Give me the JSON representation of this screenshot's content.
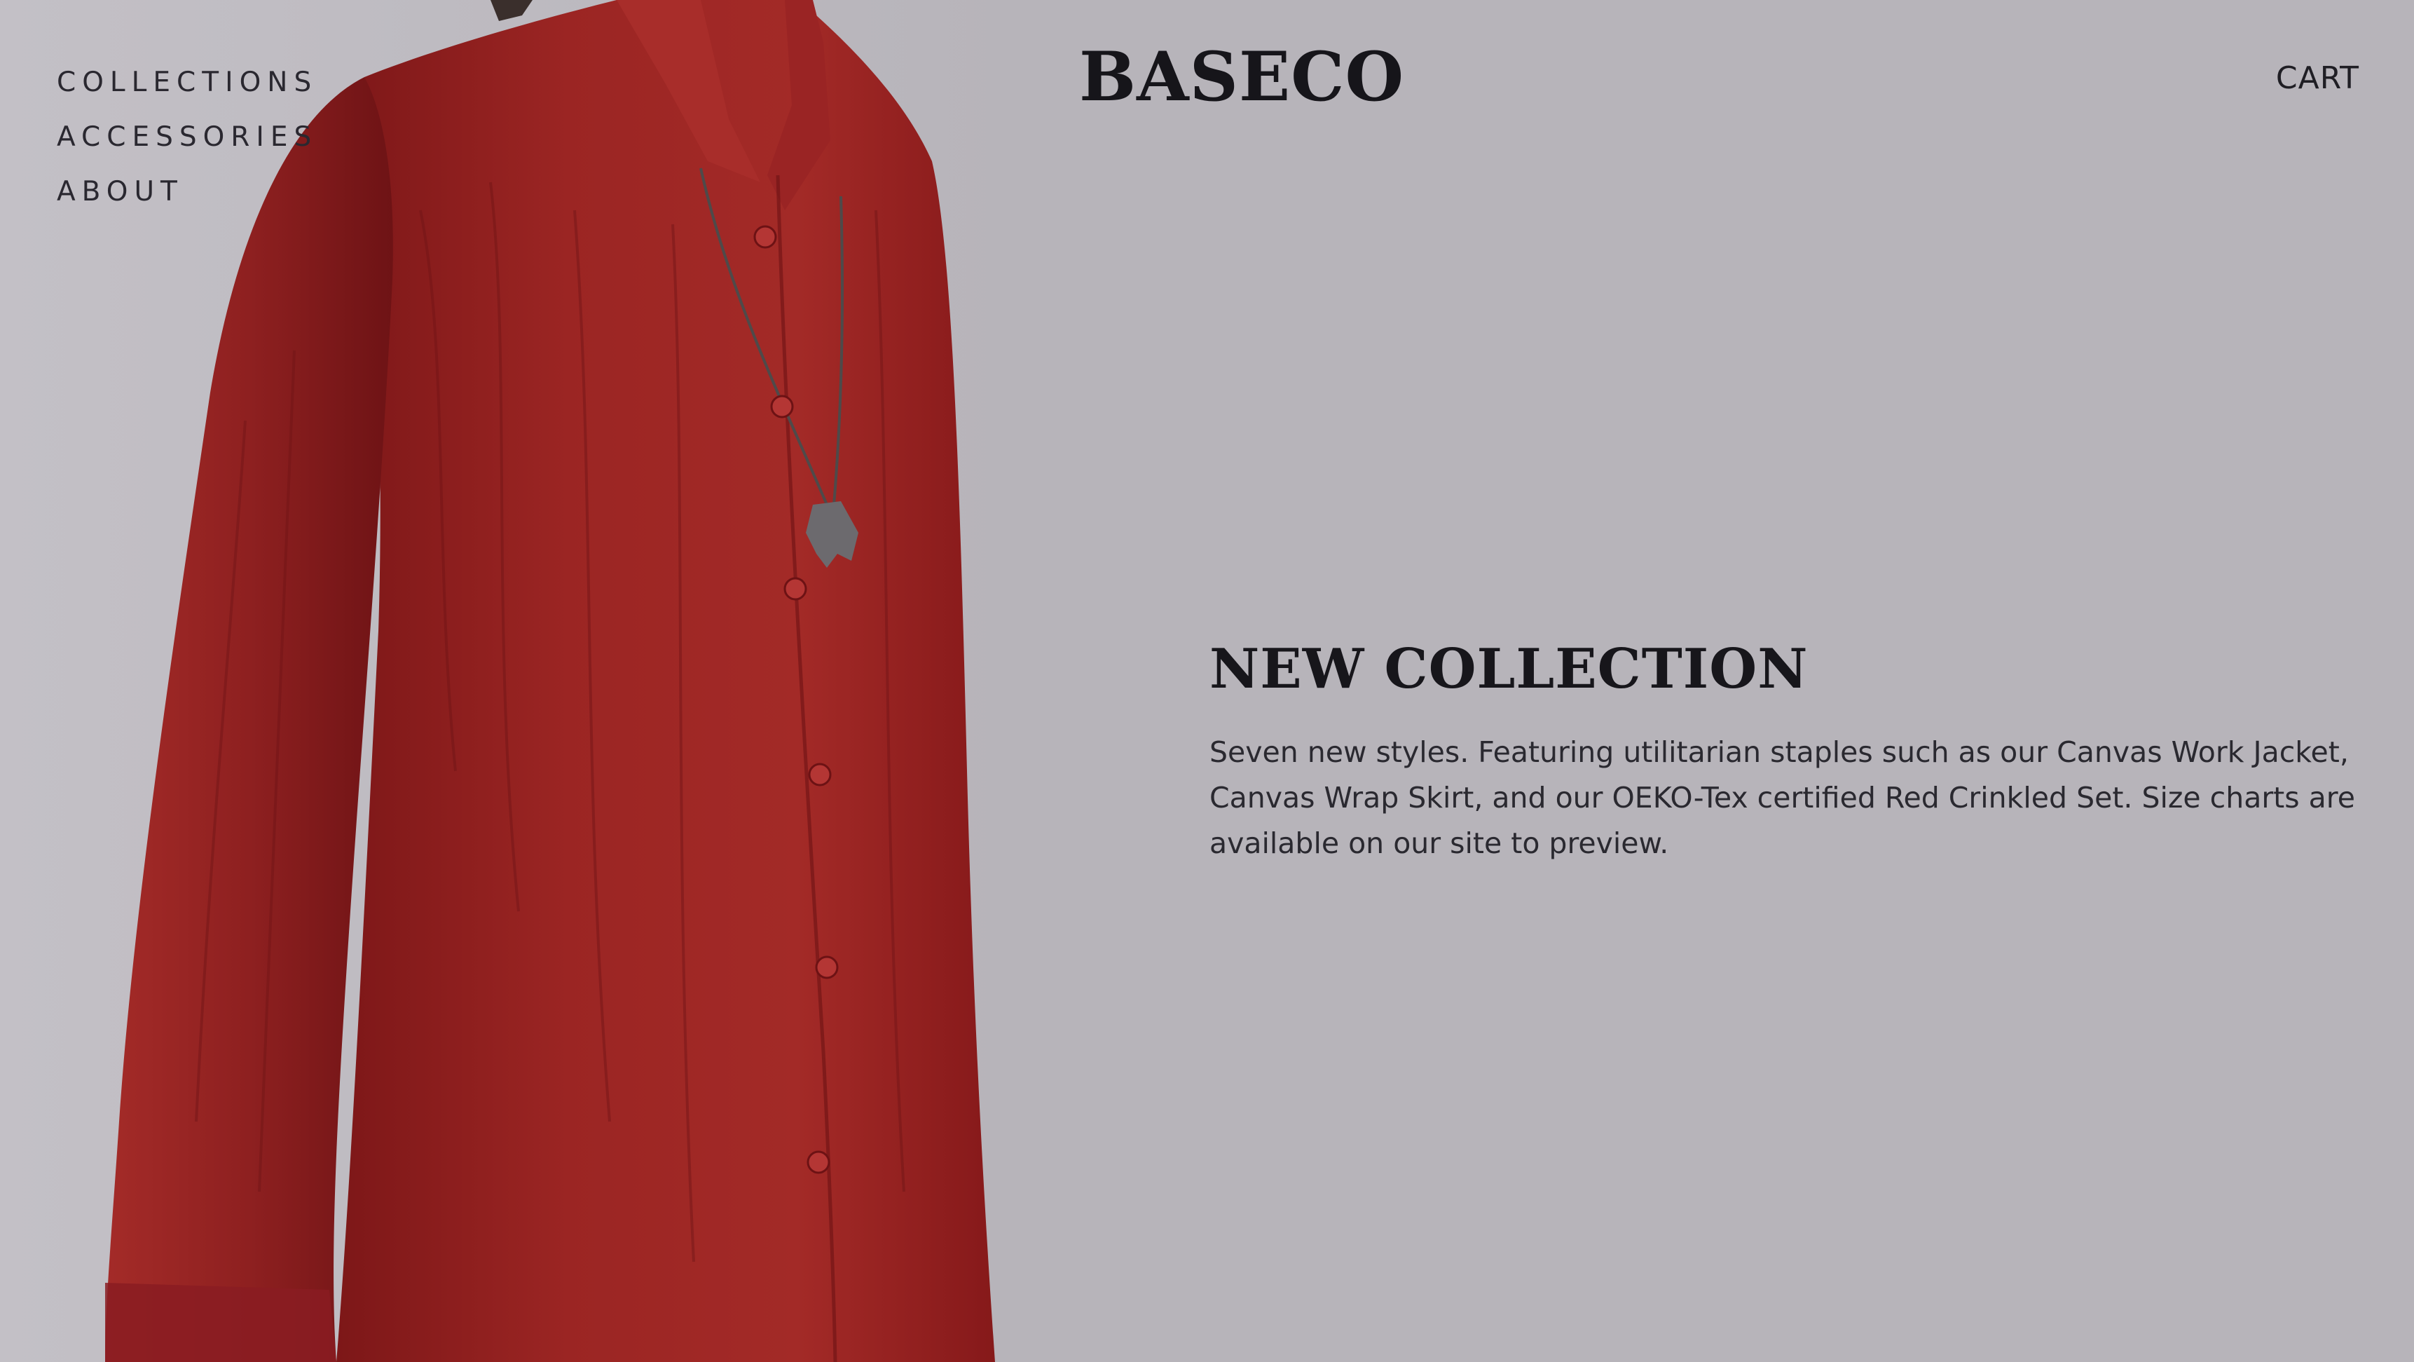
{
  "nav": {
    "items": [
      {
        "label": "COLLECTIONS"
      },
      {
        "label": "ACCESSORIES"
      },
      {
        "label": "ABOUT"
      }
    ]
  },
  "brand": {
    "logo_text": "BASECO"
  },
  "header": {
    "cart_label": "CART"
  },
  "hero": {
    "title": "NEW COLLECTION",
    "description": "Seven new styles. Featuring utilitarian staples such as our Canvas Work Jacket, Canvas Wrap Skirt, and our OEKO-Tex certified Red Crinkled Set. Size charts are available on our site to preview.",
    "image_icon": "red-shirt-photo"
  },
  "colors": {
    "page_background": "#b7b4ba",
    "shirt_red": "#8f1f1f",
    "text_dark": "#1c1b1f"
  }
}
